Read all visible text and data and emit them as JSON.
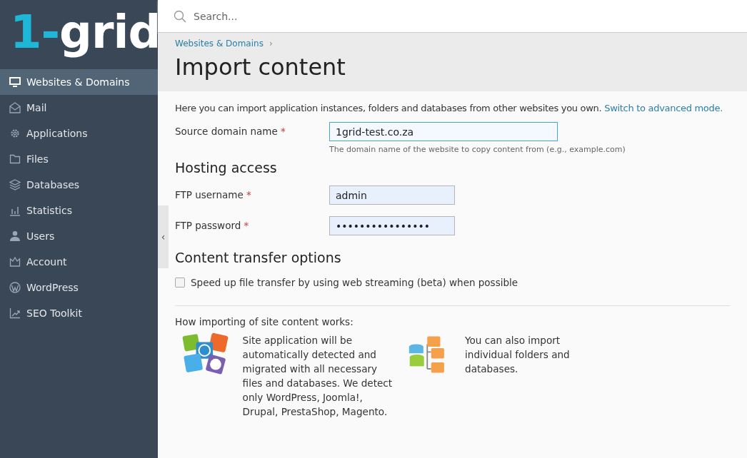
{
  "logo": {
    "accent": "1-",
    "rest": "grid"
  },
  "sidebar": {
    "items": [
      {
        "label": "Websites & Domains",
        "selected": true
      },
      {
        "label": "Mail",
        "selected": false
      },
      {
        "label": "Applications",
        "selected": false
      },
      {
        "label": "Files",
        "selected": false
      },
      {
        "label": "Databases",
        "selected": false
      },
      {
        "label": "Statistics",
        "selected": false
      },
      {
        "label": "Users",
        "selected": false
      },
      {
        "label": "Account",
        "selected": false
      },
      {
        "label": "WordPress",
        "selected": false
      },
      {
        "label": "SEO Toolkit",
        "selected": false
      }
    ]
  },
  "search": {
    "placeholder": "Search..."
  },
  "breadcrumb": {
    "link": "Websites & Domains",
    "separator": "›"
  },
  "title": "Import content",
  "intro": {
    "text": "Here you can import application instances, folders and databases from other websites you own.",
    "link": "Switch to advanced mode."
  },
  "source": {
    "label": "Source domain name",
    "required": "*",
    "value": "1grid-test.co.za",
    "hint": "The domain name of the website to copy content from (e.g., example.com)"
  },
  "hosting": {
    "heading": "Hosting access",
    "fields": [
      {
        "label": "FTP username",
        "required": "*",
        "value": "admin"
      },
      {
        "label": "FTP password",
        "required": "*",
        "value": "••••••••••••••••"
      }
    ]
  },
  "transfer": {
    "heading": "Content transfer options",
    "option": {
      "label": "Speed up file transfer by using web streaming (beta) when possible",
      "checked": false
    }
  },
  "collapse": "‹",
  "how": {
    "heading": "How importing of site content works:",
    "items": [
      {
        "kind": "apps",
        "text": "Site application will be automatically detected and migrated with all necessary files and databases. We detect only WordPress, Joomla!, Drupal, PrestaShop, Magento."
      },
      {
        "kind": "data",
        "text": "You can also import individual folders and databases."
      }
    ]
  }
}
